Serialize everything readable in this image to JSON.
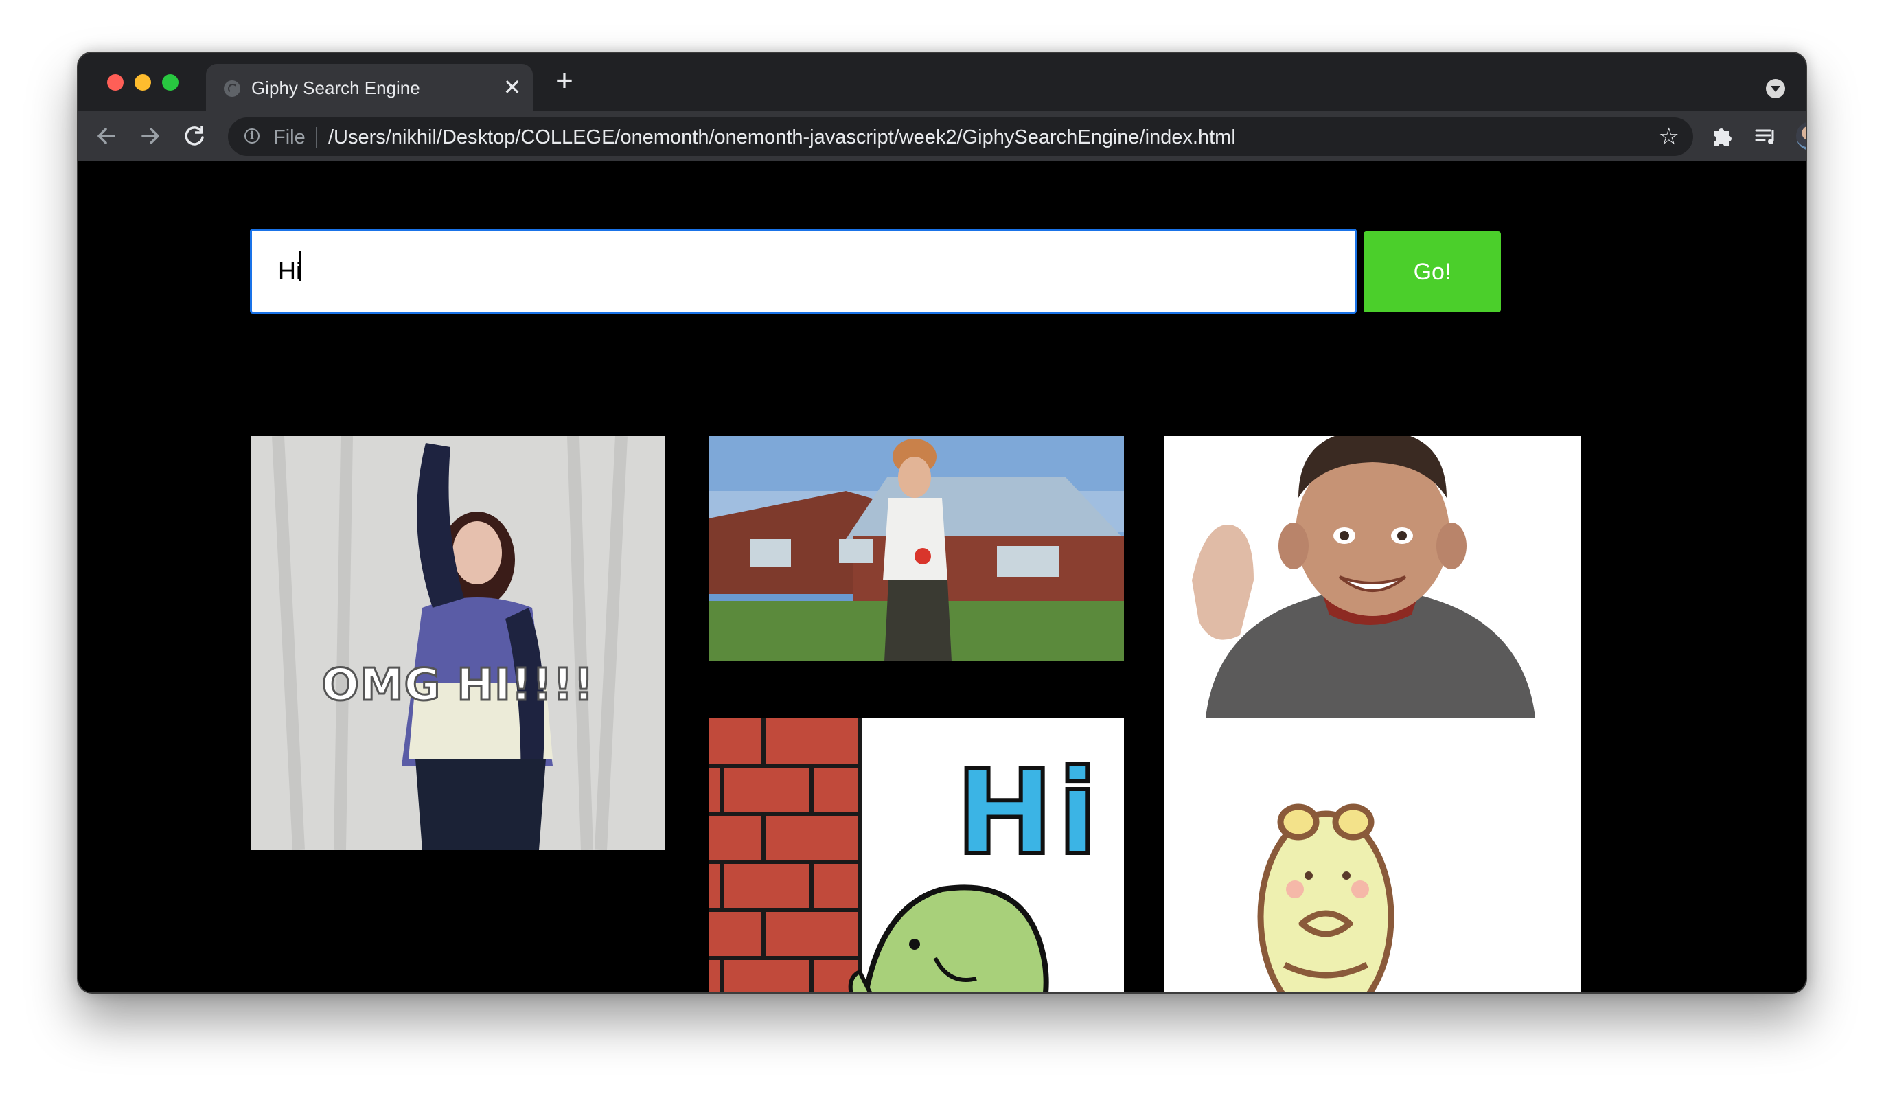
{
  "browser": {
    "tab": {
      "title": "Giphy Search Engine",
      "close": "✕"
    },
    "new_tab": "+",
    "address_bar": {
      "scheme_label": "File",
      "url": "/Users/nikhil/Desktop/COLLEGE/onemonth/onemonth-javascript/week2/GiphySearchEngine/index.html"
    },
    "icons": {
      "back": "arrow-left-icon",
      "forward": "arrow-right-icon",
      "reload": "reload-icon",
      "info": "info-icon",
      "bookmark": "star-icon",
      "extensions": "puzzle-icon",
      "media": "media-queue-icon",
      "profile": "avatar",
      "menu": "kebab-menu-icon",
      "tab_search": "chevron-down-icon"
    }
  },
  "page": {
    "search": {
      "value": "Hi"
    },
    "go_button": "Go!",
    "gifs": [
      {
        "caption": "OMG HI!!!!"
      },
      {
        "caption": ""
      },
      {
        "caption": ""
      },
      {
        "caption": "Hi"
      },
      {
        "caption": ""
      }
    ]
  },
  "colors": {
    "page_background": "#000000",
    "go_button": "#4bcf2b",
    "input_focus_border": "#1a73e8",
    "chrome_toolbar": "#35363a",
    "chrome_tabstrip": "#202124"
  }
}
